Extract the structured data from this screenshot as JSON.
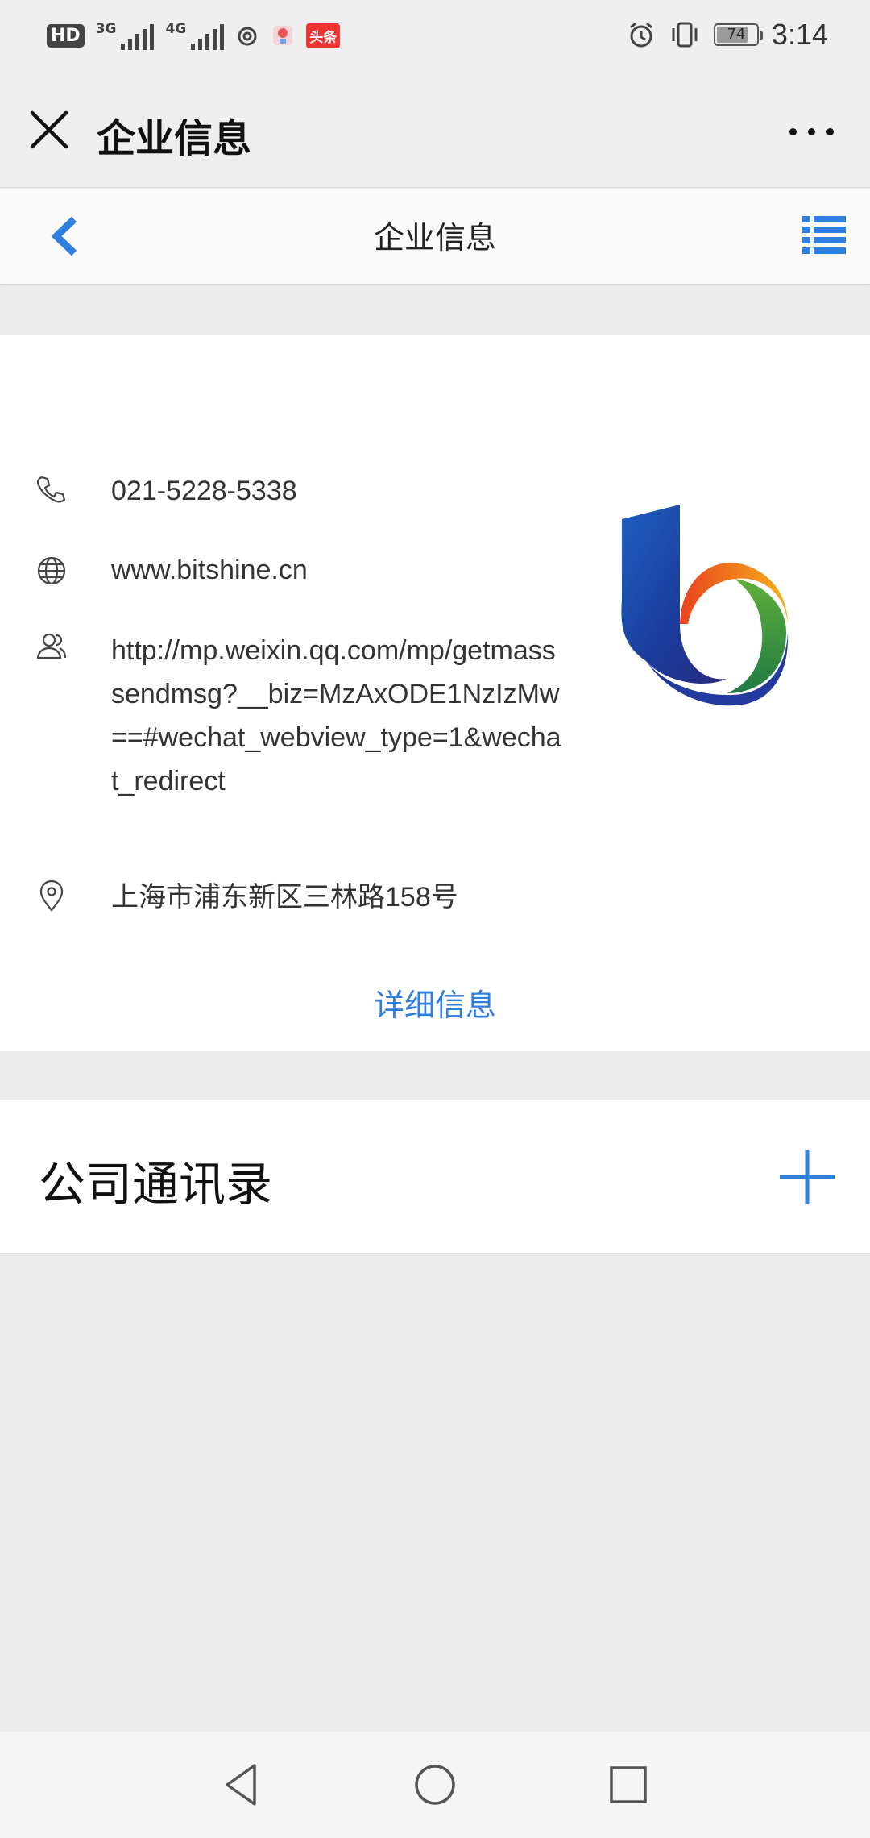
{
  "status_bar": {
    "hd_label": "HD",
    "sim1_label": "3G",
    "sim2_label": "4G",
    "toutiao_label": "头条",
    "battery_level": "74",
    "time": "3:14",
    "icons": [
      "hd-icon",
      "signal-icon",
      "signal-icon",
      "weibo-icon",
      "app-icon",
      "toutiao-icon",
      "alarm-icon",
      "vibrate-icon",
      "battery-icon"
    ]
  },
  "top_bar": {
    "title": "企业信息",
    "icons": [
      "close-icon",
      "more-icon"
    ]
  },
  "nav_bar": {
    "title": "企业信息",
    "icons": [
      "chevron-left-icon",
      "list-icon"
    ],
    "accent": "#2f7fe0"
  },
  "company": {
    "phone": "021-5228-5338",
    "website": "www.bitshine.cn",
    "wechat_link": "http://mp.weixin.qq.com/mp/getmasssendmsg?__biz=MzAxODE1NzIzMw==#wechat_webview_type=1&wechat_redirect",
    "address": "上海市浦东新区三林路158号",
    "detail_link": "详细信息",
    "icons": [
      "phone-icon",
      "globe-icon",
      "people-icon",
      "location-icon",
      "company-logo"
    ]
  },
  "contacts": {
    "title": "公司通讯录",
    "icons": [
      "plus-icon"
    ]
  },
  "system_nav": {
    "icons": [
      "back-triangle-icon",
      "home-circle-icon",
      "recents-square-icon"
    ]
  }
}
